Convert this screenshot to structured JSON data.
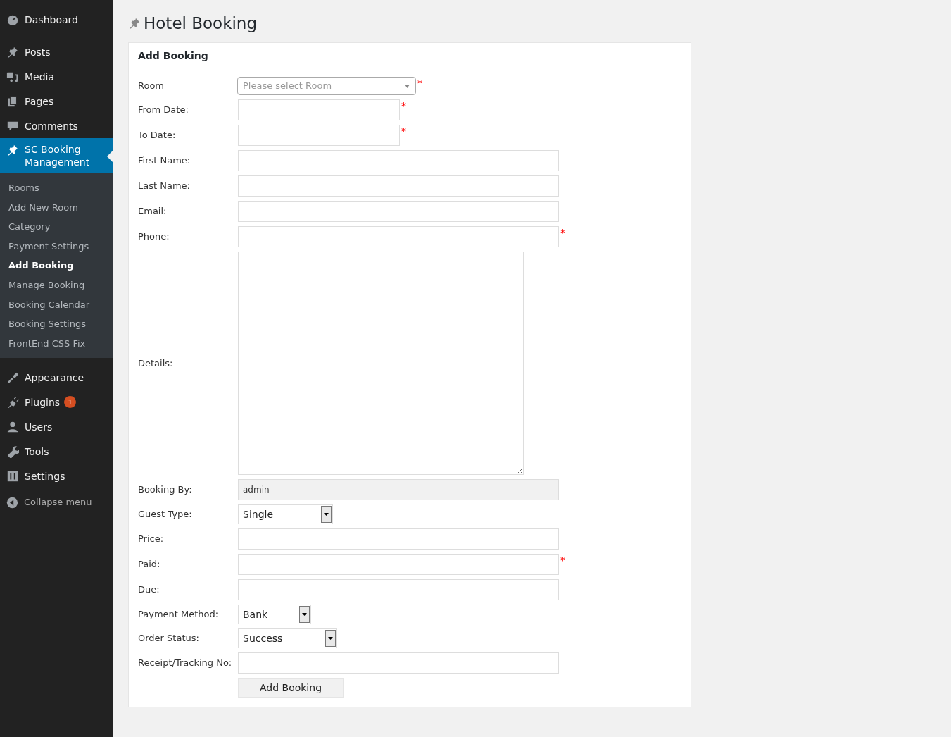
{
  "sidebar": {
    "items": [
      {
        "label": "Dashboard",
        "selected": false
      },
      {
        "label": "Posts",
        "selected": false
      },
      {
        "label": "Media",
        "selected": false
      },
      {
        "label": "Pages",
        "selected": false
      },
      {
        "label": "Comments",
        "selected": false
      },
      {
        "label": "SC Booking Management",
        "selected": true,
        "submenu": [
          {
            "label": "Rooms",
            "selected": false
          },
          {
            "label": "Add New Room",
            "selected": false
          },
          {
            "label": "Category",
            "selected": false
          },
          {
            "label": "Payment Settings",
            "selected": false
          },
          {
            "label": "Add Booking",
            "selected": true
          },
          {
            "label": "Manage Booking",
            "selected": false
          },
          {
            "label": "Booking Calendar",
            "selected": false
          },
          {
            "label": "Booking Settings",
            "selected": false
          },
          {
            "label": "FrontEnd CSS Fix",
            "selected": false
          }
        ]
      },
      {
        "label": "Appearance",
        "selected": false
      },
      {
        "label": "Plugins",
        "selected": false,
        "badge": "1"
      },
      {
        "label": "Users",
        "selected": false
      },
      {
        "label": "Tools",
        "selected": false
      },
      {
        "label": "Settings",
        "selected": false
      }
    ],
    "collapse": "Collapse menu"
  },
  "page_title": "Hotel Booking",
  "form": {
    "title": "Add Booking",
    "fields": [
      {
        "label": "Room",
        "kind": "combo",
        "placeholder": "Please select Room",
        "marker": "*"
      },
      {
        "label": "From Date:",
        "kind": "text",
        "marker": "*"
      },
      {
        "label": "To Date:",
        "kind": "text",
        "marker": "*"
      },
      {
        "label": "First Name:",
        "kind": "text"
      },
      {
        "label": "Last Name:",
        "kind": "text"
      },
      {
        "label": "Email:",
        "kind": "text"
      },
      {
        "label": "Phone:",
        "kind": "text",
        "marker": "*"
      },
      {
        "label": "Details:",
        "kind": "textarea"
      },
      {
        "label": "Booking By:",
        "kind": "readonly",
        "value": "admin"
      },
      {
        "label": "Guest Type:",
        "kind": "select",
        "value": "Single"
      },
      {
        "label": "Price:",
        "kind": "text"
      },
      {
        "label": "Paid:",
        "kind": "text",
        "marker": "*"
      },
      {
        "label": "Due:",
        "kind": "text"
      },
      {
        "label": "Payment Method:",
        "kind": "select",
        "value": "Bank"
      },
      {
        "label": "Order Status:",
        "kind": "select",
        "value": "Success"
      },
      {
        "label": "Receipt/Tracking No:",
        "kind": "text"
      }
    ],
    "submit": "Add Booking"
  }
}
